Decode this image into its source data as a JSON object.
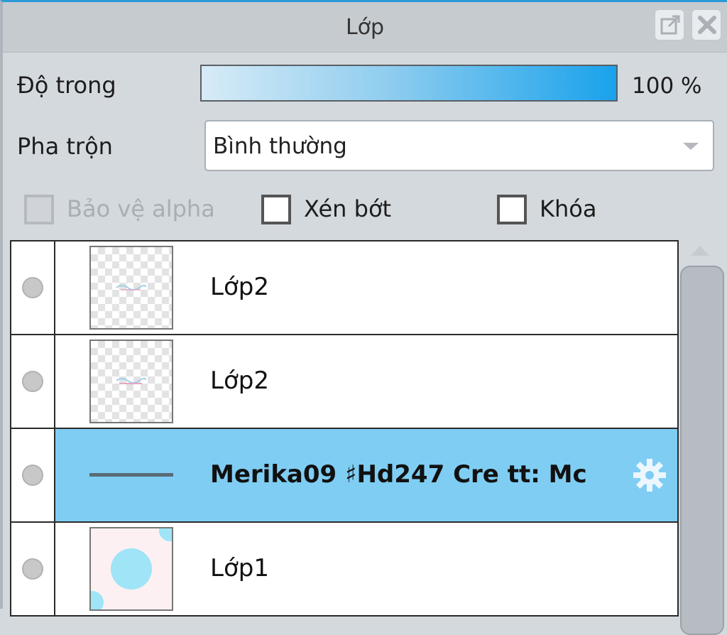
{
  "panel": {
    "title": "Lớp",
    "opacity_label": "Độ trong",
    "opacity_value": "100 %",
    "opacity_percent": 100,
    "blend_label": "Pha trộn",
    "blend_value": "Bình thường",
    "checkboxes": {
      "alpha": {
        "label": "Bảo vệ alpha",
        "checked": false,
        "disabled": true
      },
      "clip": {
        "label": "Xén bớt",
        "checked": false,
        "disabled": false
      },
      "lock": {
        "label": "Khóa",
        "checked": false,
        "disabled": false
      }
    }
  },
  "layers": [
    {
      "name": "Lớp2",
      "selected": false,
      "thumbnail": "transparent-sketch"
    },
    {
      "name": "Lớp2",
      "selected": false,
      "thumbnail": "transparent-sketch"
    },
    {
      "name": "Merika09 ♯Hd247 Cre tt: Mc",
      "selected": true,
      "thumbnail": "line"
    },
    {
      "name": "Lớp1",
      "selected": false,
      "thumbnail": "pink-dots"
    }
  ],
  "icons": {
    "popout": "popout-icon",
    "close": "close-icon",
    "settings": "gear-icon"
  },
  "colors": {
    "accent": "#2b9bd8",
    "selection": "#7fcdf3",
    "opacity_bar_end": "#19a2ec"
  }
}
